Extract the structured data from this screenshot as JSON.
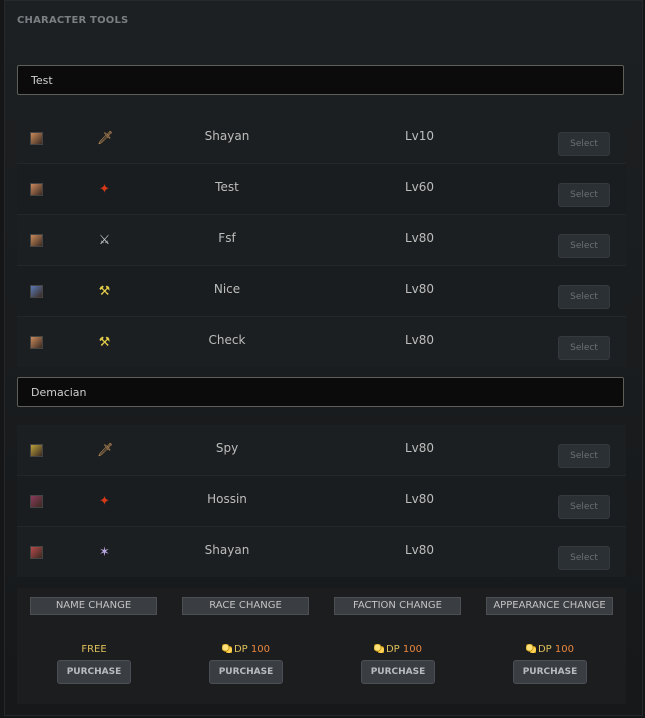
{
  "section_title": "CHARACTER TOOLS",
  "realms": [
    {
      "name": "Test",
      "characters": [
        {
          "race_icon": "human-face-icon",
          "race_color": "#c98a5a",
          "class_icon": "rogue-class-icon",
          "class_glyph": "🗡",
          "class_color": "#d8a060",
          "name": "Shayan",
          "level": "Lv10",
          "select_label": "Select"
        },
        {
          "race_icon": "human-face-icon",
          "race_color": "#c9885c",
          "class_icon": "mage-class-icon",
          "class_glyph": "✦",
          "class_color": "#d43a1a",
          "name": "Test",
          "level": "Lv60",
          "select_label": "Select"
        },
        {
          "race_icon": "human-face-icon",
          "race_color": "#c98a5a",
          "class_icon": "warrior-class-icon",
          "class_glyph": "⚔",
          "class_color": "#cfcfcf",
          "name": "Fsf",
          "level": "Lv80",
          "select_label": "Select"
        },
        {
          "race_icon": "draenei-face-icon",
          "race_color": "#5a7ab4",
          "class_icon": "paladin-class-icon",
          "class_glyph": "⚒",
          "class_color": "#e6d04a",
          "name": "Nice",
          "level": "Lv80",
          "select_label": "Select"
        },
        {
          "race_icon": "human-face-icon",
          "race_color": "#c98a5a",
          "class_icon": "paladin-class-icon",
          "class_glyph": "⚒",
          "class_color": "#e6d04a",
          "name": "Check",
          "level": "Lv80",
          "select_label": "Select"
        }
      ]
    },
    {
      "name": "Demacian",
      "characters": [
        {
          "race_icon": "troll-face-icon",
          "race_color": "#b9a03a",
          "class_icon": "rogue-class-icon",
          "class_glyph": "🗡",
          "class_color": "#d8a060",
          "name": "Spy",
          "level": "Lv80",
          "select_label": "Select"
        },
        {
          "race_icon": "undead-face-icon",
          "race_color": "#8a3a5a",
          "class_icon": "mage-class-icon",
          "class_glyph": "✦",
          "class_color": "#d43a1a",
          "name": "Hossin",
          "level": "Lv80",
          "select_label": "Select"
        },
        {
          "race_icon": "orc-face-icon",
          "race_color": "#b44a4a",
          "class_icon": "priest-class-icon",
          "class_glyph": "✶",
          "class_color": "#b9a7e0",
          "name": "Shayan",
          "level": "Lv80",
          "select_label": "Select"
        }
      ]
    }
  ],
  "services": [
    {
      "title": "NAME CHANGE",
      "currency": "",
      "price": "FREE",
      "button": "PURCHASE"
    },
    {
      "title": "RACE CHANGE",
      "currency": "DP",
      "price": "100",
      "button": "PURCHASE"
    },
    {
      "title": "FACTION CHANGE",
      "currency": "DP",
      "price": "100",
      "button": "PURCHASE"
    },
    {
      "title": "APPEARANCE CHANGE",
      "currency": "DP",
      "price": "100",
      "button": "PURCHASE"
    }
  ]
}
